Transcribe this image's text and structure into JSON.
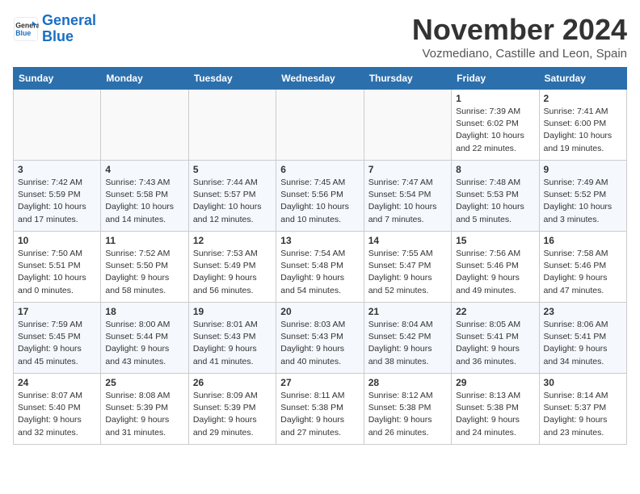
{
  "logo": {
    "line1": "General",
    "line2": "Blue"
  },
  "title": "November 2024",
  "location": "Vozmediano, Castille and Leon, Spain",
  "weekdays": [
    "Sunday",
    "Monday",
    "Tuesday",
    "Wednesday",
    "Thursday",
    "Friday",
    "Saturday"
  ],
  "weeks": [
    [
      {
        "day": "",
        "info": ""
      },
      {
        "day": "",
        "info": ""
      },
      {
        "day": "",
        "info": ""
      },
      {
        "day": "",
        "info": ""
      },
      {
        "day": "",
        "info": ""
      },
      {
        "day": "1",
        "info": "Sunrise: 7:39 AM\nSunset: 6:02 PM\nDaylight: 10 hours and 22 minutes."
      },
      {
        "day": "2",
        "info": "Sunrise: 7:41 AM\nSunset: 6:00 PM\nDaylight: 10 hours and 19 minutes."
      }
    ],
    [
      {
        "day": "3",
        "info": "Sunrise: 7:42 AM\nSunset: 5:59 PM\nDaylight: 10 hours and 17 minutes."
      },
      {
        "day": "4",
        "info": "Sunrise: 7:43 AM\nSunset: 5:58 PM\nDaylight: 10 hours and 14 minutes."
      },
      {
        "day": "5",
        "info": "Sunrise: 7:44 AM\nSunset: 5:57 PM\nDaylight: 10 hours and 12 minutes."
      },
      {
        "day": "6",
        "info": "Sunrise: 7:45 AM\nSunset: 5:56 PM\nDaylight: 10 hours and 10 minutes."
      },
      {
        "day": "7",
        "info": "Sunrise: 7:47 AM\nSunset: 5:54 PM\nDaylight: 10 hours and 7 minutes."
      },
      {
        "day": "8",
        "info": "Sunrise: 7:48 AM\nSunset: 5:53 PM\nDaylight: 10 hours and 5 minutes."
      },
      {
        "day": "9",
        "info": "Sunrise: 7:49 AM\nSunset: 5:52 PM\nDaylight: 10 hours and 3 minutes."
      }
    ],
    [
      {
        "day": "10",
        "info": "Sunrise: 7:50 AM\nSunset: 5:51 PM\nDaylight: 10 hours and 0 minutes."
      },
      {
        "day": "11",
        "info": "Sunrise: 7:52 AM\nSunset: 5:50 PM\nDaylight: 9 hours and 58 minutes."
      },
      {
        "day": "12",
        "info": "Sunrise: 7:53 AM\nSunset: 5:49 PM\nDaylight: 9 hours and 56 minutes."
      },
      {
        "day": "13",
        "info": "Sunrise: 7:54 AM\nSunset: 5:48 PM\nDaylight: 9 hours and 54 minutes."
      },
      {
        "day": "14",
        "info": "Sunrise: 7:55 AM\nSunset: 5:47 PM\nDaylight: 9 hours and 52 minutes."
      },
      {
        "day": "15",
        "info": "Sunrise: 7:56 AM\nSunset: 5:46 PM\nDaylight: 9 hours and 49 minutes."
      },
      {
        "day": "16",
        "info": "Sunrise: 7:58 AM\nSunset: 5:46 PM\nDaylight: 9 hours and 47 minutes."
      }
    ],
    [
      {
        "day": "17",
        "info": "Sunrise: 7:59 AM\nSunset: 5:45 PM\nDaylight: 9 hours and 45 minutes."
      },
      {
        "day": "18",
        "info": "Sunrise: 8:00 AM\nSunset: 5:44 PM\nDaylight: 9 hours and 43 minutes."
      },
      {
        "day": "19",
        "info": "Sunrise: 8:01 AM\nSunset: 5:43 PM\nDaylight: 9 hours and 41 minutes."
      },
      {
        "day": "20",
        "info": "Sunrise: 8:03 AM\nSunset: 5:43 PM\nDaylight: 9 hours and 40 minutes."
      },
      {
        "day": "21",
        "info": "Sunrise: 8:04 AM\nSunset: 5:42 PM\nDaylight: 9 hours and 38 minutes."
      },
      {
        "day": "22",
        "info": "Sunrise: 8:05 AM\nSunset: 5:41 PM\nDaylight: 9 hours and 36 minutes."
      },
      {
        "day": "23",
        "info": "Sunrise: 8:06 AM\nSunset: 5:41 PM\nDaylight: 9 hours and 34 minutes."
      }
    ],
    [
      {
        "day": "24",
        "info": "Sunrise: 8:07 AM\nSunset: 5:40 PM\nDaylight: 9 hours and 32 minutes."
      },
      {
        "day": "25",
        "info": "Sunrise: 8:08 AM\nSunset: 5:39 PM\nDaylight: 9 hours and 31 minutes."
      },
      {
        "day": "26",
        "info": "Sunrise: 8:09 AM\nSunset: 5:39 PM\nDaylight: 9 hours and 29 minutes."
      },
      {
        "day": "27",
        "info": "Sunrise: 8:11 AM\nSunset: 5:38 PM\nDaylight: 9 hours and 27 minutes."
      },
      {
        "day": "28",
        "info": "Sunrise: 8:12 AM\nSunset: 5:38 PM\nDaylight: 9 hours and 26 minutes."
      },
      {
        "day": "29",
        "info": "Sunrise: 8:13 AM\nSunset: 5:38 PM\nDaylight: 9 hours and 24 minutes."
      },
      {
        "day": "30",
        "info": "Sunrise: 8:14 AM\nSunset: 5:37 PM\nDaylight: 9 hours and 23 minutes."
      }
    ]
  ]
}
